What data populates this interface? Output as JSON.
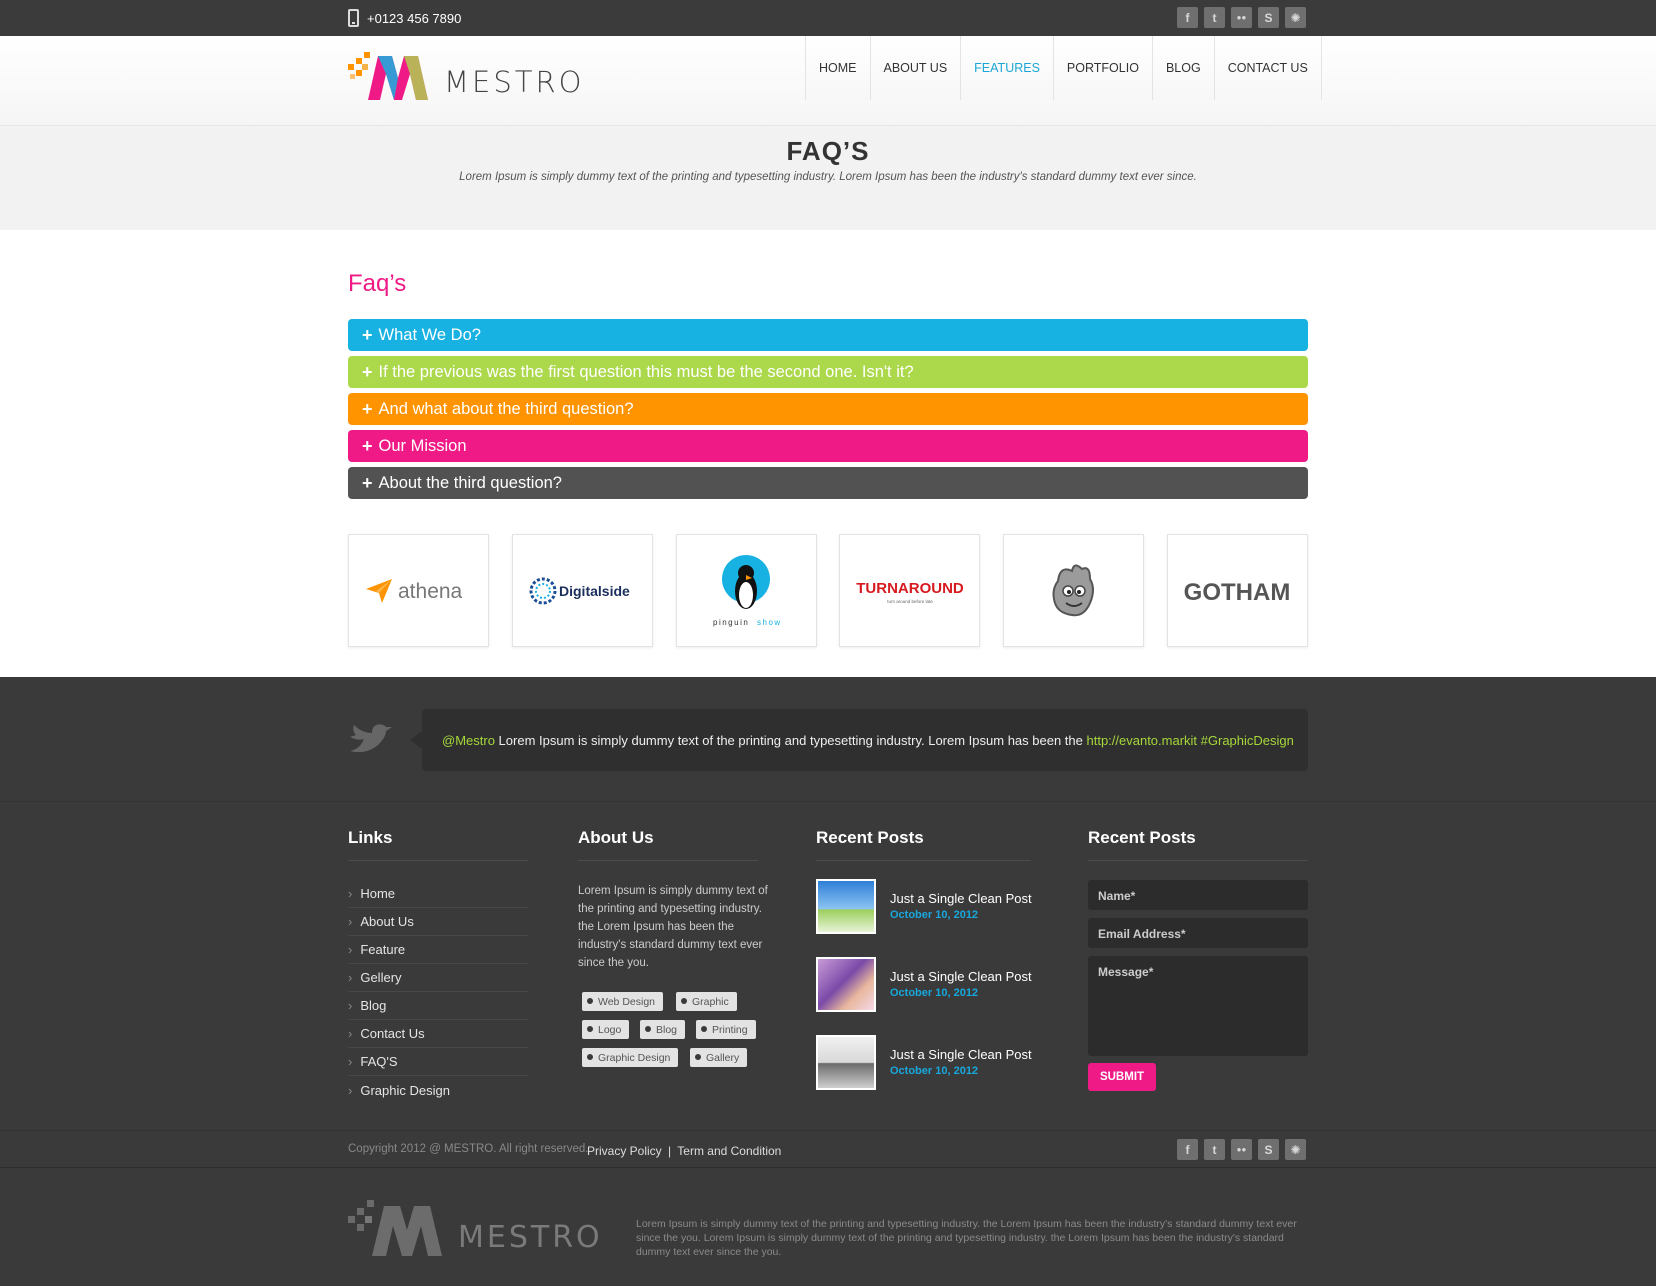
{
  "topbar": {
    "phone": "+0123 456 7890",
    "social": [
      "f",
      "t",
      "●●",
      "S",
      "✺"
    ]
  },
  "brand": {
    "name": "MESTRO"
  },
  "nav": {
    "items": [
      "HOME",
      "ABOUT US",
      "FEATURES",
      "PORTFOLIO",
      "BLOG",
      "CONTACT US"
    ],
    "active": "FEATURES"
  },
  "page": {
    "title": "FAQ’S",
    "subtitle": "Lorem Ipsum is simply dummy text of the printing and typesetting industry. Lorem Ipsum has been the industry's standard dummy text ever since."
  },
  "faq": {
    "heading": "Faq’s",
    "items": [
      {
        "label": "What We Do?",
        "color": "#17b1e2"
      },
      {
        "label": "If the previous was the first question this must be the second one. Isn't it?",
        "color": "#acd84c"
      },
      {
        "label": "And what about the third question?",
        "color": "#ff9300"
      },
      {
        "label": "Our Mission",
        "color": "#ef1a86"
      },
      {
        "label": "About the third question?",
        "color": "#525252"
      }
    ]
  },
  "clients": {
    "athena": "athena",
    "digitalside": "Digitalside",
    "pinguin": "pinguin",
    "pinguin_show": "show",
    "turnaround": "TURNAROUND",
    "turnaround_tag": "turn around before late",
    "gotham": "GOTHAM"
  },
  "tweet": {
    "handle": "@Mestro",
    "text": " Lorem Ipsum is simply dummy text of the printing and typesetting industry. Lorem Ipsum has been the ",
    "link": "http://evanto.markit",
    "hashtag": " #GraphicDesign"
  },
  "footer": {
    "links_title": "Links",
    "links": [
      "Home",
      "About Us",
      "Feature",
      "Gellery",
      "Blog",
      "Contact Us",
      "FAQ'S",
      "Graphic Design"
    ],
    "about_title": "About Us",
    "about_text": "Lorem Ipsum is simply dummy text of the printing and typesetting industry. the Lorem Ipsum has been the industry's standard dummy text ever since the you.",
    "tags": [
      "Web Design",
      "Graphic",
      "Logo",
      "Blog",
      "Printing",
      "Graphic Design",
      "Gallery"
    ],
    "posts_title": "Recent Posts",
    "posts": [
      {
        "title": "Just a Single Clean Post",
        "date": "October 10, 2012"
      },
      {
        "title": "Just a Single Clean Post",
        "date": "October 10, 2012"
      },
      {
        "title": "Just a Single Clean Post",
        "date": "October 10, 2012"
      }
    ],
    "form_title": "Recent Posts",
    "form": {
      "name_placeholder": "Name*",
      "email_placeholder": "Email Address*",
      "message_placeholder": "Message*",
      "submit_label": "SUBMIT"
    }
  },
  "copyright": {
    "text": "Copyright 2012 @ MESTRO. All right reserved.",
    "privacy": "Privacy Policy",
    "separator": "|",
    "terms": "Term and Condition"
  },
  "bottom": {
    "text": "Lorem Ipsum is simply dummy text of the printing and typesetting industry. the Lorem Ipsum has been the industry's standard dummy text ever since the you. Lorem Ipsum is simply dummy text of the printing and typesetting industry. the Lorem Ipsum has been the industry's standard dummy text ever since the you."
  },
  "colors": {
    "accent_blue": "#17b1e2",
    "accent_pink": "#ef1a86",
    "accent_green": "#acd84c",
    "accent_orange": "#ff9300",
    "dark": "#3a3a3a"
  }
}
